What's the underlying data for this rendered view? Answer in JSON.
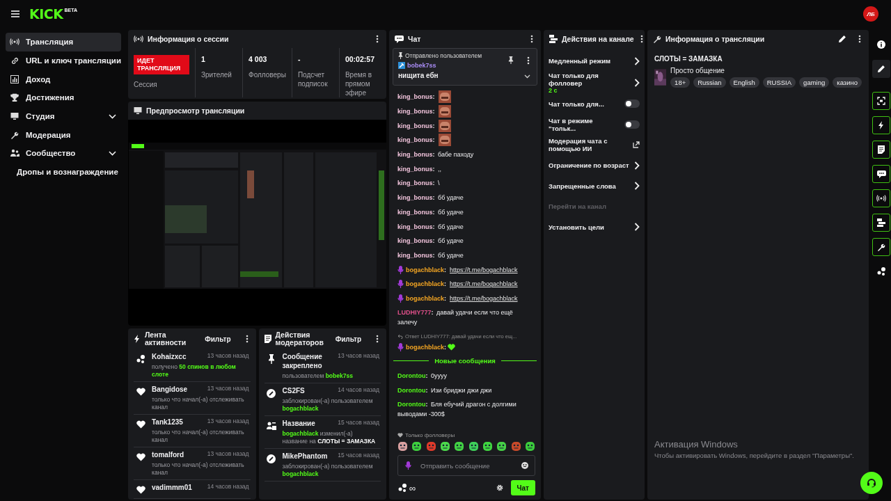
{
  "topbar": {
    "logo": "KICK",
    "logo_badge": "BETA",
    "avatar": "ЛБ"
  },
  "sidebar": {
    "items": [
      {
        "label": "Трансляция",
        "kind": "link",
        "selected": true
      },
      {
        "label": "URL и ключ трансляции",
        "kind": "link",
        "selected": false
      },
      {
        "label": "Доход",
        "kind": "link",
        "selected": false
      },
      {
        "label": "Достижения",
        "kind": "link",
        "selected": false
      },
      {
        "label": "Студия",
        "kind": "group",
        "expanded": false,
        "selected": false
      },
      {
        "label": "Модерация",
        "kind": "link",
        "selected": false
      },
      {
        "label": "Сообщество",
        "kind": "group",
        "expanded": false,
        "selected": false
      },
      {
        "label": "Дропы и вознаграждение",
        "kind": "link",
        "selected": false
      }
    ]
  },
  "session": {
    "title": "Информация о сессии",
    "live_badge": "ИДЕТ ТРАНСЛЯЦИЯ",
    "live_label": "Сессия",
    "stats": [
      {
        "value": "1",
        "label": "Зрителей"
      },
      {
        "value": "4 003",
        "label": "Фолловеры"
      },
      {
        "value": "-",
        "label": "Подсчет подписок"
      },
      {
        "value": "00:02:57",
        "label": "Время в прямом эфире"
      }
    ]
  },
  "preview": {
    "title": "Предпросмотр трансляции",
    "kind": "picture"
  },
  "activity": {
    "title": "Лента активности",
    "filter": "Фильтр",
    "items": [
      {
        "kind": "reward",
        "name": "Kohaizxcc",
        "time": "13 часов назад",
        "parts": [
          {
            "text": "получено",
            "kind": "plain"
          },
          {
            "text": "50 спинов в любом слоте",
            "kind": "user"
          }
        ]
      },
      {
        "kind": "follow",
        "name": "Bangidose",
        "time": "13 часов назад",
        "parts": [
          {
            "text": "только что начал(-а) отслеживать канал",
            "kind": "plain"
          }
        ]
      },
      {
        "kind": "follow",
        "name": "Tank1235",
        "time": "13 часов назад",
        "parts": [
          {
            "text": "только что начал(-а) отслеживать канал",
            "kind": "plain"
          }
        ]
      },
      {
        "kind": "follow",
        "name": "tomalford",
        "time": "13 часов назад",
        "parts": [
          {
            "text": "только что начал(-а) отслеживать канал",
            "kind": "plain"
          }
        ]
      },
      {
        "kind": "follow",
        "name": "vadimmm01",
        "time": "14 часов назад"
      }
    ]
  },
  "mod_actions": {
    "title": "Действия модераторов",
    "filter": "Фильтр",
    "items": [
      {
        "kind": "pin",
        "name": "Сообщение закреплено",
        "time": "13 часов назад",
        "parts": [
          {
            "text": "пользователем",
            "kind": "plain"
          },
          {
            "text": "bobek7ss",
            "kind": "user"
          }
        ]
      },
      {
        "kind": "ban",
        "name": "CS2FS",
        "time": "14 часов назад",
        "parts": [
          {
            "text": "заблокирован(-а) пользователем",
            "kind": "plain"
          },
          {
            "text": "bogachblack",
            "kind": "user"
          }
        ]
      },
      {
        "kind": "title",
        "name": "Название",
        "time": "15 часов назад",
        "parts": [
          {
            "text": "bogachblack",
            "kind": "user"
          },
          {
            "text": "изменил(-а) название на",
            "kind": "plain"
          },
          {
            "text": "СЛОТЫ = ЗАМАЗКА",
            "kind": "bold"
          }
        ]
      },
      {
        "kind": "ban",
        "name": "MikePhantom",
        "time": "15 часов назад",
        "parts": [
          {
            "text": "заблокирован(-а) пользователем",
            "kind": "plain"
          },
          {
            "text": "bogachblack",
            "kind": "user"
          }
        ]
      }
    ]
  },
  "chat": {
    "title": "Чат",
    "pinned": {
      "caption": "Отправлено пользователем",
      "user": "bobek7ss",
      "text": "нищита ебн"
    },
    "messages": [
      {
        "kind": "emote",
        "user": "king_bonus",
        "sep": ":",
        "color": "#f2c4dc",
        "has_badge": false
      },
      {
        "kind": "emote",
        "user": "king_bonus",
        "sep": ":",
        "color": "#f2c4dc",
        "has_badge": false
      },
      {
        "kind": "emote",
        "user": "king_bonus",
        "sep": ":",
        "color": "#f2c4dc",
        "has_badge": false
      },
      {
        "kind": "emote",
        "user": "king_bonus",
        "sep": ":",
        "color": "#f2c4dc",
        "has_badge": false
      },
      {
        "kind": "text",
        "user": "king_bonus",
        "sep": ":",
        "color": "#f2c4dc",
        "has_badge": false,
        "text": "бабе паходу"
      },
      {
        "kind": "text",
        "user": "king_bonus",
        "sep": ":",
        "color": "#f2c4dc",
        "has_badge": false,
        "text": ",,"
      },
      {
        "kind": "text",
        "user": "king_bonus",
        "sep": ":",
        "color": "#f2c4dc",
        "has_badge": false,
        "text": "\\"
      },
      {
        "kind": "text",
        "user": "king_bonus",
        "sep": ":",
        "color": "#f2c4dc",
        "has_badge": false,
        "text": "бб удаче"
      },
      {
        "kind": "text",
        "user": "king_bonus",
        "sep": ":",
        "color": "#f2c4dc",
        "has_badge": false,
        "text": "бб удаче"
      },
      {
        "kind": "text",
        "user": "king_bonus",
        "sep": ":",
        "color": "#f2c4dc",
        "has_badge": false,
        "text": "бб удаче"
      },
      {
        "kind": "text",
        "user": "king_bonus",
        "sep": ":",
        "color": "#f2c4dc",
        "has_badge": false,
        "text": "бб удаче"
      },
      {
        "kind": "text",
        "user": "king_bonus",
        "sep": ":",
        "color": "#f2c4dc",
        "has_badge": false,
        "text": "бб удаче"
      },
      {
        "kind": "link",
        "user": "bogachblack",
        "sep": ":",
        "color": "#f5a623",
        "has_badge": true,
        "text": "https://t.me/bogachblack"
      },
      {
        "kind": "link",
        "user": "bogachblack",
        "sep": ":",
        "color": "#f5a623",
        "has_badge": true,
        "text": "https://t.me/bogachblack"
      },
      {
        "kind": "link",
        "user": "bogachblack",
        "sep": ":",
        "color": "#f5a623",
        "has_badge": true,
        "text": "https://t.me/bogachblack"
      },
      {
        "kind": "text",
        "user": "LUDHIY777",
        "sep": ":",
        "color": "#e0508a",
        "has_badge": false,
        "text": "давай удачи если что ещё залечу"
      },
      {
        "kind": "reply",
        "reply": "Ответ LUDHIY777: давай удачи если что ещ...",
        "user": "bogachblack",
        "sep": ":",
        "color": "#f5a623",
        "has_badge": true
      },
      {
        "kind": "divider",
        "text": "Новые сообщения"
      },
      {
        "kind": "text",
        "user": "Dorontou",
        "sep": ":",
        "color": "#53fc18",
        "has_badge": false,
        "text": "0уууу"
      },
      {
        "kind": "text",
        "user": "Dorontou",
        "sep": ":",
        "color": "#53fc18",
        "has_badge": false,
        "text": "Изи бриджи джи джи"
      },
      {
        "kind": "text",
        "user": "Dorontou",
        "sep": ":",
        "color": "#53fc18",
        "has_badge": false,
        "text": "Бля ебучий драгон с долгими выводами -300$"
      }
    ],
    "followers_only": "Только фолловеры",
    "input": {
      "placeholder": "Отправить сообщение"
    },
    "counter": "∞",
    "send": "Чат"
  },
  "channel_actions": {
    "title": "Действия на канале",
    "items": [
      {
        "kind": "chevron",
        "label": "Медленный режим",
        "disabled": false
      },
      {
        "kind": "chevron",
        "label": "Чат только для фолловер",
        "sub": "2 с",
        "disabled": false
      },
      {
        "kind": "toggle",
        "label": "Чат только для...",
        "on": false,
        "disabled": false
      },
      {
        "kind": "toggle",
        "label": "Чат в режиме \"тольк...",
        "on": false,
        "disabled": false
      },
      {
        "kind": "external",
        "label": "Модерация чата с помощью ИИ",
        "disabled": false
      },
      {
        "kind": "chevron",
        "label": "Ограничение по возраст",
        "disabled": false
      },
      {
        "kind": "chevron",
        "label": "Запрещенные слова",
        "disabled": false
      },
      {
        "kind": "plain",
        "label": "Перейти на канал",
        "disabled": true
      },
      {
        "kind": "chevron",
        "label": "Установить цели",
        "disabled": false
      }
    ]
  },
  "stream_info": {
    "title": "Информация о трансляции",
    "stream_title": "СЛОТЫ = ЗАМАЗКА",
    "category": "Просто общение",
    "tags": [
      "18+",
      "Russian",
      "English",
      "RUSSIA",
      "gaming",
      "казино"
    ]
  },
  "os_notice": {
    "title": "Активация Windows",
    "text": "Чтобы активировать Windows, перейдите в раздел \"Параметры\"."
  }
}
